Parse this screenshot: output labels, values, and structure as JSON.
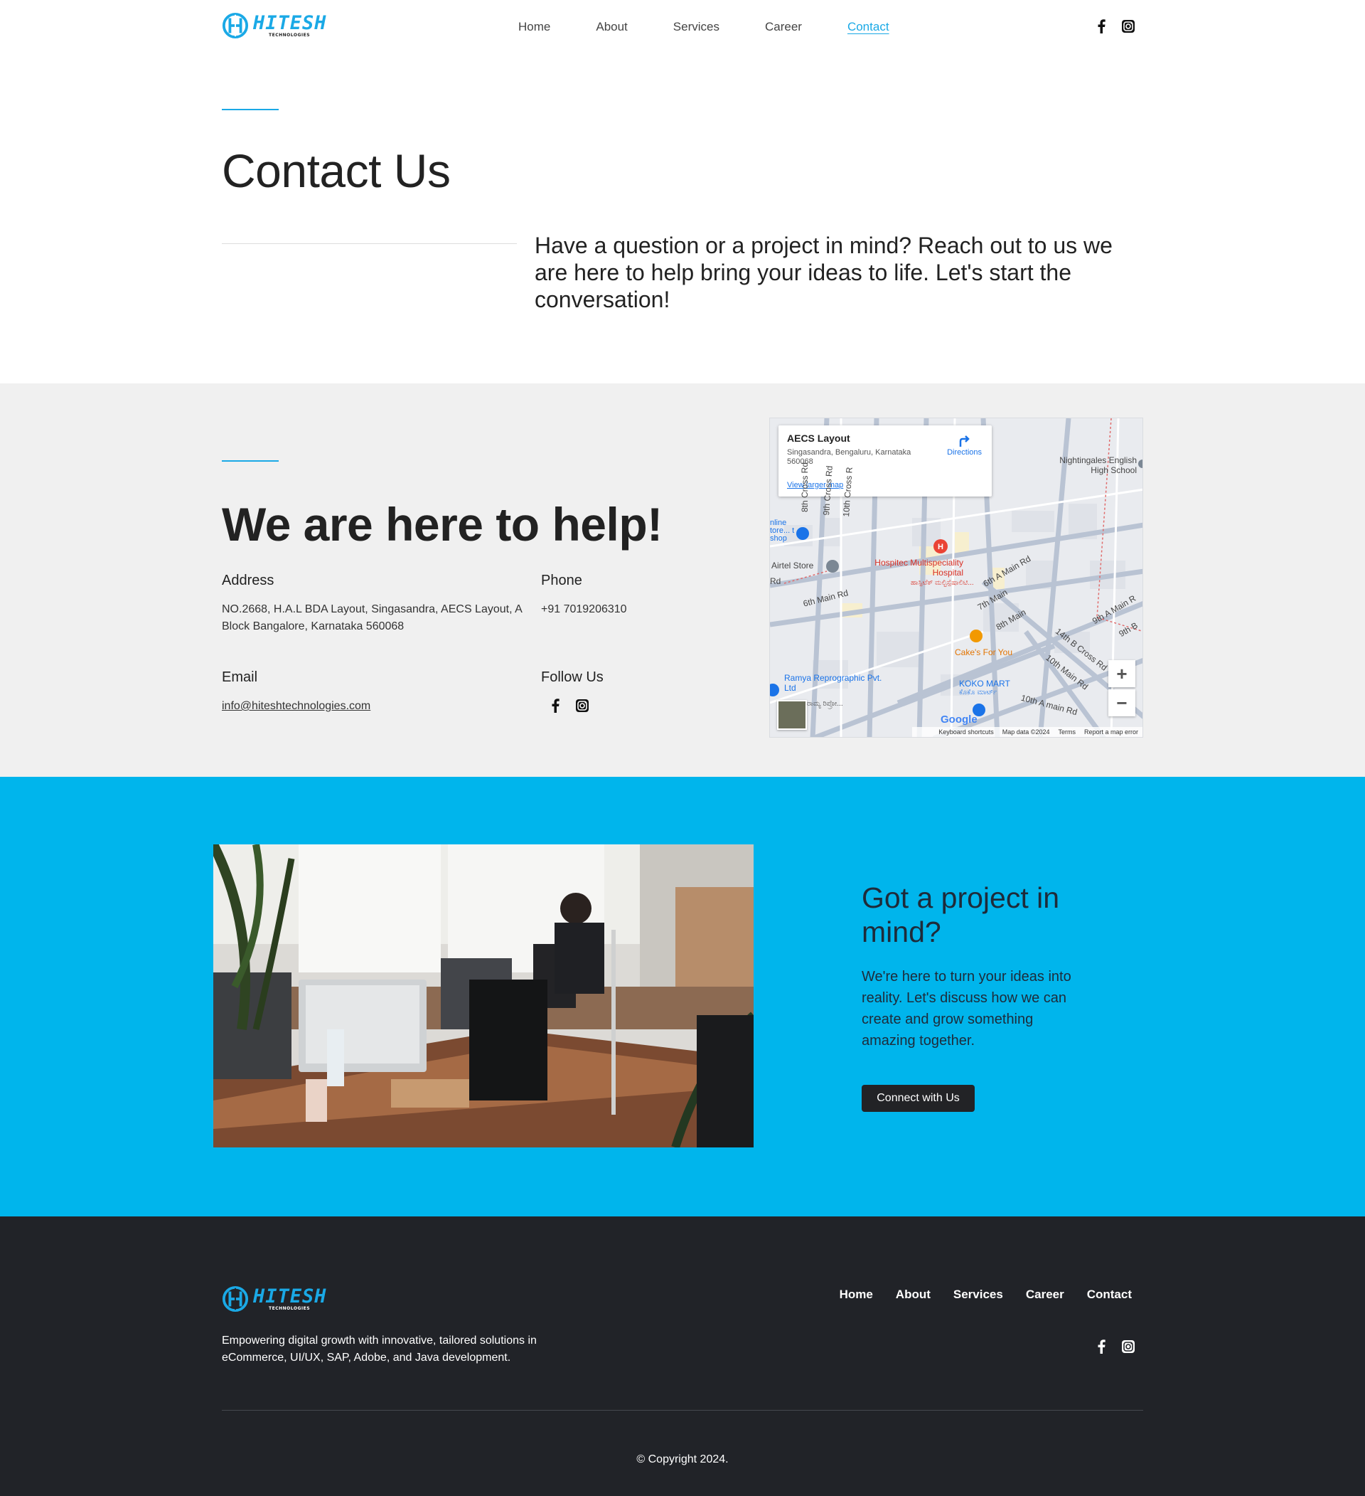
{
  "brand": {
    "name": "HITESH",
    "tagline": "TECHNOLOGIES",
    "accent_color": "#1aa9e6"
  },
  "nav": {
    "items": [
      {
        "label": "Home"
      },
      {
        "label": "About"
      },
      {
        "label": "Services"
      },
      {
        "label": "Career"
      },
      {
        "label": "Contact",
        "active": true
      }
    ]
  },
  "social": {
    "facebook_icon": "facebook-icon",
    "instagram_icon": "instagram-icon"
  },
  "hero": {
    "title": "Contact Us",
    "text": "Have a question or a project in mind? Reach out to us we are here to help bring your ideas to life. Let's start the conversation!"
  },
  "help": {
    "title": "We are here to help!",
    "address_label": "Address",
    "address_value": "NO.2668, H.A.L BDA Layout, Singasandra, AECS Layout, A Block Bangalore, Karnataka 560068",
    "phone_label": "Phone",
    "phone_value": "+91 7019206310",
    "email_label": "Email",
    "email_value": "info@hiteshtechnologies.com",
    "follow_label": "Follow Us",
    "background": "#f0f0f0"
  },
  "map": {
    "place_title": "AECS Layout",
    "place_address": "Singasandra, Bengaluru, Karnataka 560068",
    "view_larger": "View larger map",
    "directions": "Directions",
    "labels": {
      "school": "Nightingales English High School",
      "airtel": "Airtel Store",
      "hospital": "Hospitec Multispeciality Hospital",
      "hospital_local": "ಹಾಸ್ಪಿಟೆಕ್ ಮಲ್ಟಿಸ್ಪೆಷಾಲಿಟಿ...",
      "cakes": "Cake's For You",
      "ramya": "Ramya Reprographic Pvt. Ltd",
      "koko": "KOKO MART",
      "koko_local": "ಕೊಕೊ ಮಾರ್ಟ್",
      "road_6th_main": "6th Main Rd",
      "road_6th_a": "6th A Main Rd",
      "road_7th": "7th Main",
      "road_8th": "8th Main",
      "road_9th_a": "9th A Main R",
      "road_9th_b": "9th B",
      "road_14th_b": "14th B Cross Rd",
      "road_10th_main": "10th Main Rd",
      "road_10th_a": "10th A main Rd",
      "road_8th_cross": "8th Cross Rd",
      "road_9th_cross": "9th Cross Rd",
      "road_10th_cross": "10th Cross R",
      "online_store": "nline tore... t shop",
      "road_rd": "Rd",
      "local_partial": "ರಾಮ್ಯ ರಿಪ್ರೋ..."
    },
    "zoom_in": "+",
    "zoom_out": "−",
    "google": "Google",
    "footer_shortcuts": "Keyboard shortcuts",
    "footer_data": "Map data ©2024",
    "footer_terms": "Terms",
    "footer_report": "Report a map error"
  },
  "project": {
    "title": "Got a project in mind?",
    "text": "We're here to turn your ideas into reality. Let's discuss how we can create and grow something amazing together.",
    "button": "Connect with Us",
    "background": "#00b5ec"
  },
  "footer": {
    "nav": [
      "Home",
      "About",
      "Services",
      "Career",
      "Contact"
    ],
    "description": "Empowering digital growth with innovative, tailored solutions in eCommerce, UI/UX, SAP, Adobe, and Java development.",
    "copyright": "© Copyright 2024.",
    "background": "#212328"
  }
}
